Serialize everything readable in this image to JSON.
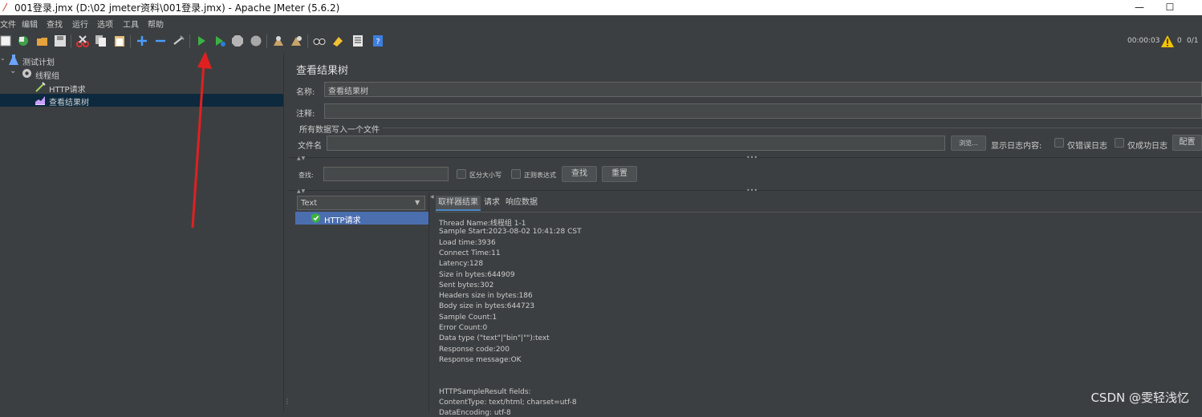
{
  "window": {
    "title": "001登录.jmx (D:\\02 jmeter资料\\001登录.jmx) - Apache JMeter (5.6.2)",
    "minimize": "—",
    "maximize": "☐"
  },
  "menu": [
    "文件",
    "编辑",
    "查找",
    "运行",
    "选项",
    "工具",
    "帮助"
  ],
  "toolbar": {
    "timer": "00:00:03",
    "warnings": "0",
    "threads": "0/1"
  },
  "tree": [
    {
      "label": "测试计划",
      "icon": "flask-icon"
    },
    {
      "label": "线程组",
      "icon": "gear-icon"
    },
    {
      "label": "HTTP请求",
      "icon": "pipette-icon"
    },
    {
      "label": "查看结果树",
      "icon": "graph-icon"
    }
  ],
  "panel": {
    "title": "查看结果树",
    "name_label": "名称:",
    "name_value": "查看结果树",
    "comment_label": "注释:",
    "comment_value": "",
    "file_group": "所有数据写入一个文件",
    "filename_label": "文件名",
    "filename_value": "",
    "browse": "浏览...",
    "log_label": "显示日志内容:",
    "errors_only": "仅错误日志",
    "success_only": "仅成功日志",
    "configure": "配置",
    "search_label": "查找:",
    "search_value": "",
    "case_sensitive": "区分大小写",
    "regex": "正则表达式",
    "find_button": "查找",
    "reset_button": "重置"
  },
  "renderer": {
    "selected": "Text"
  },
  "results": [
    {
      "label": "HTTP请求",
      "status": "success"
    }
  ],
  "tabs": [
    "取样器结果",
    "请求",
    "响应数据"
  ],
  "sampler_result": [
    "Thread Name:线程组 1-1",
    "Sample Start:2023-08-02 10:41:28 CST",
    "Load time:3936",
    "Connect Time:11",
    "Latency:128",
    "Size in bytes:644909",
    "Sent bytes:302",
    "Headers size in bytes:186",
    "Body size in bytes:644723",
    "Sample Count:1",
    "Error Count:0",
    "Data type (\"text\"|\"bin\"|\"\"):text",
    "Response code:200",
    "Response message:OK",
    "",
    "",
    "HTTPSampleResult fields:",
    "ContentType: text/html; charset=utf-8",
    "DataEncoding: utf-8"
  ],
  "watermark": "CSDN @雯轻浅忆",
  "colors": {
    "background": "#3c3f41",
    "selection": "#4b6eaf",
    "tree_selection": "#0d293e",
    "annotation_arrow": "#e02020"
  }
}
